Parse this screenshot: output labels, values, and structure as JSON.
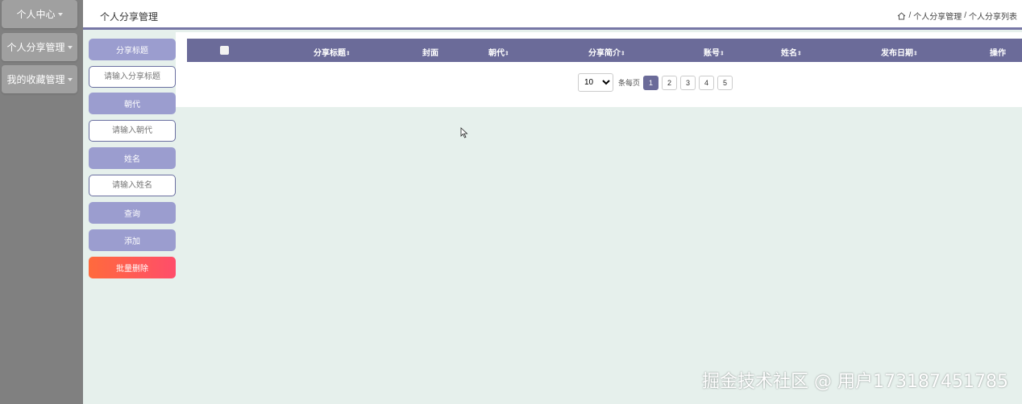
{
  "sidebar": {
    "items": [
      {
        "label": "个人中心"
      },
      {
        "label": "个人分享管理"
      },
      {
        "label": "我的收藏管理"
      }
    ]
  },
  "header": {
    "title": "个人分享管理",
    "breadcrumb": [
      "个人分享管理",
      "个人分享列表"
    ],
    "separator": "/"
  },
  "filters": {
    "title_label": "分享标题",
    "title_placeholder": "请输入分享标题",
    "dynasty_label": "朝代",
    "dynasty_placeholder": "请输入朝代",
    "name_label": "姓名",
    "name_placeholder": "请输入姓名",
    "query_button": "查询",
    "add_button": "添加",
    "batch_delete_button": "批量删除"
  },
  "table": {
    "columns": [
      {
        "label": "分享标题",
        "sortable": true
      },
      {
        "label": "封面",
        "sortable": false
      },
      {
        "label": "朝代",
        "sortable": true
      },
      {
        "label": "分享简介",
        "sortable": true
      },
      {
        "label": "账号",
        "sortable": true
      },
      {
        "label": "姓名",
        "sortable": true
      },
      {
        "label": "发布日期",
        "sortable": true
      },
      {
        "label": "操作",
        "sortable": false
      }
    ],
    "sort_glyph": "⇕"
  },
  "pagination": {
    "page_size": "10",
    "per_page_label": "条每页",
    "pages": [
      "1",
      "2",
      "3",
      "4",
      "5"
    ],
    "current_page": "1"
  },
  "watermark": "掘金技术社区 @ 用户173187451785",
  "colors": {
    "header_bar": "#6b6b99",
    "filter_label": "#9b9dcf",
    "danger": "#ff5a4d",
    "content_bg": "#e6f0ec",
    "sidebar_bg": "#808080"
  }
}
